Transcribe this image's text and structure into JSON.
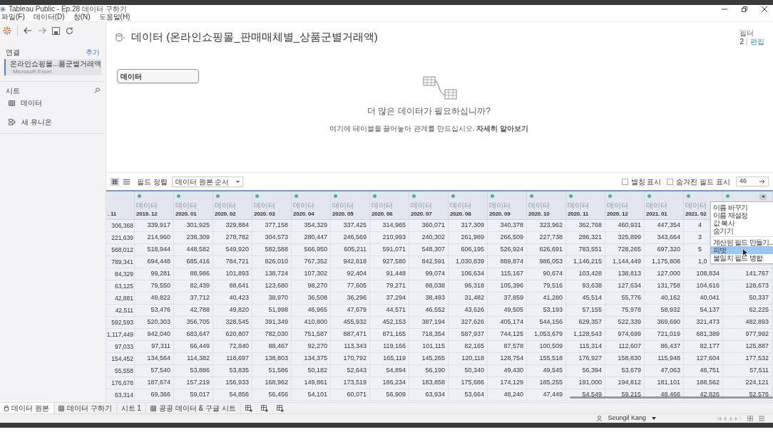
{
  "window": {
    "title": "Tableau Public - Ep.28 데이터 구하기"
  },
  "menu_bar": [
    "파일(F)",
    "데이터(D)",
    "창(N)",
    "도움말(H)"
  ],
  "sidebar": {
    "connections_label": "연결",
    "add_link": "추가",
    "connections": [
      {
        "name": "온라인쇼핑몰...품군별거래액",
        "type": "Microsoft Excel",
        "selected": true
      }
    ],
    "sheets_label": "시트",
    "sheets": [
      {
        "kind": "sheet",
        "label": "데이터"
      },
      {
        "kind": "union",
        "label": "새 유니온"
      }
    ]
  },
  "datasource": {
    "title": "데이터 (온라인쇼핑몰_판매매체별_상품군별거래액)",
    "filter_label": "필터",
    "filter_count": "2",
    "filter_edit": "편집"
  },
  "canvas": {
    "table": "데이터",
    "heading": "더 많은 데이터가 필요하십니까?",
    "hint": "여기에 테이블을 끌어놓아 관계를 만드십시오. **자세히 알아보기**"
  },
  "grid_toolbar": {
    "sort_label": "필드 정렬",
    "sort_value": "데이터 원본 순서",
    "options": [
      {
        "label": "별칭 표시",
        "checked": false
      },
      {
        "label": "숨겨진 필드 표시",
        "checked": false
      }
    ],
    "rows_value": "46"
  },
  "table": {
    "columns": [
      {
        "kind": "cut",
        "label": ". 11"
      },
      {
        "kind": "field",
        "type": "데이터",
        "label": "2019. 12",
        "menu_button": false
      },
      {
        "kind": "field",
        "type": "데이터",
        "label": "2020. 01",
        "menu_button": false
      },
      {
        "kind": "field",
        "type": "데이터",
        "label": "2020. 02",
        "menu_button": false
      },
      {
        "kind": "field",
        "type": "데이터",
        "label": "2020. 03",
        "menu_button": false
      },
      {
        "kind": "field",
        "type": "데이터",
        "label": "2020. 04",
        "menu_button": false
      },
      {
        "kind": "field",
        "type": "데이터",
        "label": "2020. 05",
        "menu_button": false
      },
      {
        "kind": "field",
        "type": "데이터",
        "label": "2020. 06",
        "menu_button": false
      },
      {
        "kind": "field",
        "type": "데이터",
        "label": "2020. 07",
        "menu_button": false
      },
      {
        "kind": "field",
        "type": "데이터",
        "label": "2020. 08",
        "menu_button": false
      },
      {
        "kind": "field",
        "type": "데이터",
        "label": "2020. 09",
        "menu_button": false
      },
      {
        "kind": "field",
        "type": "데이터",
        "label": "2020. 10",
        "menu_button": false
      },
      {
        "kind": "field",
        "type": "데이터",
        "label": "2020. 11",
        "menu_button": false
      },
      {
        "kind": "field",
        "type": "데이터",
        "label": "2020. 12",
        "menu_button": false
      },
      {
        "kind": "field",
        "type": "데이터",
        "label": "2021. 01",
        "menu_button": false
      },
      {
        "kind": "field",
        "type": "데이터",
        "label": "2021. 02",
        "menu_button": false
      },
      {
        "kind": "hidden",
        "menu_button": true
      }
    ],
    "rows": [
      {
        "cut": true,
        "cells": [
          "306,368",
          "339,917",
          "301,925",
          "329,884",
          "377,158",
          "354,329",
          "337,425",
          "314,965",
          "360,071",
          "317,309",
          "340,378",
          "323,962",
          "362,768",
          "460,931",
          "447,354",
          "4"
        ]
      },
      {
        "cut": true,
        "cells": [
          "221,639",
          "214,960",
          "238,309",
          "278,782",
          "304,573",
          "280,447",
          "246,569",
          "210,993",
          "240,302",
          "261,989",
          "266,509",
          "227,738",
          "286,321",
          "325,899",
          "343,664",
          "3"
        ]
      },
      {
        "cut": true,
        "cells": [
          "568,012",
          "518,944",
          "448,582",
          "549,920",
          "582,588",
          "566,950",
          "605,211",
          "591,071",
          "548,307",
          "606,195",
          "526,924",
          "626,691",
          "783,551",
          "728,265",
          "697,320",
          "5"
        ]
      },
      {
        "cut": true,
        "cells": [
          "789,341",
          "694,448",
          "685,416",
          "784,721",
          "826,010",
          "767,352",
          "942,818",
          "927,580",
          "842,591",
          "1,030,839",
          "889,874",
          "986,053",
          "1,146,215",
          "1,144,449",
          "1,175,808",
          "1,0"
        ]
      },
      {
        "cut": false,
        "cells": [
          "84,329",
          "99,281",
          "88,986",
          "101,893",
          "138,724",
          "107,302",
          "92,404",
          "91,448",
          "99,074",
          "106,634",
          "115,167",
          "90,674",
          "103,428",
          "138,813",
          "127,000",
          "108,834",
          "141,767"
        ]
      },
      {
        "cut": false,
        "cells": [
          "63,125",
          "79,550",
          "82,439",
          "88,641",
          "123,680",
          "98,270",
          "77,605",
          "79,271",
          "88,038",
          "96,318",
          "105,396",
          "79,516",
          "93,638",
          "127,634",
          "131,758",
          "104,616",
          "128,673"
        ]
      },
      {
        "cut": false,
        "cells": [
          "42,881",
          "49,822",
          "37,712",
          "40,423",
          "38,970",
          "36,508",
          "36,296",
          "37,294",
          "38,493",
          "31,482",
          "37,859",
          "41,280",
          "45,514",
          "55,776",
          "40,162",
          "40,041",
          "50,337"
        ]
      },
      {
        "cut": false,
        "cells": [
          "42,511",
          "53,476",
          "42,788",
          "49,820",
          "51,998",
          "46,965",
          "47,679",
          "44,571",
          "46,552",
          "43,626",
          "49,505",
          "53,193",
          "57,155",
          "75,978",
          "58,932",
          "54,137",
          "62,225"
        ]
      },
      {
        "cut": false,
        "cells": [
          "592,593",
          "520,303",
          "356,705",
          "328,545",
          "391,349",
          "410,800",
          "455,932",
          "452,153",
          "387,194",
          "327,626",
          "405,174",
          "544,156",
          "629,357",
          "522,339",
          "369,690",
          "321,473",
          "482,893"
        ]
      },
      {
        "cut": false,
        "cells": [
          "1,117,449",
          "942,040",
          "683,647",
          "620,807",
          "782,030",
          "751,587",
          "887,471",
          "871,165",
          "718,354",
          "587,937",
          "744,125",
          "1,053,679",
          "1,128,543",
          "974,699",
          "721,019",
          "681,389",
          "977,992"
        ]
      },
      {
        "cut": false,
        "cells": [
          "97,033",
          "97,311",
          "66,449",
          "72,840",
          "88,467",
          "92,270",
          "113,343",
          "119,166",
          "101,115",
          "82,165",
          "87,578",
          "100,509",
          "115,314",
          "112,607",
          "86,437",
          "82,177",
          "125,887"
        ]
      },
      {
        "cut": false,
        "cells": [
          "154,452",
          "134,564",
          "114,382",
          "118,697",
          "138,803",
          "134,375",
          "170,792",
          "165,119",
          "145,265",
          "120,118",
          "128,754",
          "155,518",
          "176,927",
          "158,830",
          "115,948",
          "127,604",
          "177,532"
        ]
      },
      {
        "cut": false,
        "cells": [
          "55,558",
          "57,540",
          "53,886",
          "53,835",
          "51,586",
          "50,182",
          "52,643",
          "54,894",
          "56,190",
          "50,340",
          "49,430",
          "49,545",
          "56,394",
          "53,679",
          "47,063",
          "48,751",
          "57,511"
        ]
      },
      {
        "cut": false,
        "cells": [
          "176,678",
          "187,674",
          "157,219",
          "156,933",
          "168,962",
          "149,861",
          "173,519",
          "186,234",
          "183,858",
          "175,686",
          "174,129",
          "185,255",
          "191,000",
          "194,812",
          "181,101",
          "188,562",
          "224,121"
        ]
      },
      {
        "cut": false,
        "cells": [
          "63,314",
          "69,366",
          "59,017",
          "54,856",
          "56,456",
          "54,101",
          "60,071",
          "56,909",
          "63,934",
          "53,664",
          "48,240",
          "47,449",
          "54,549",
          "59,215",
          "48,466",
          "42,826",
          "52,576"
        ]
      }
    ]
  },
  "context_menu": [
    {
      "kind": "item",
      "label": "이름 바꾸기",
      "selected": false
    },
    {
      "kind": "item",
      "label": "이름 재설정",
      "selected": false
    },
    {
      "kind": "item",
      "label": "값 복사",
      "selected": false
    },
    {
      "kind": "item",
      "label": "숨기기",
      "selected": false
    },
    {
      "kind": "separator"
    },
    {
      "kind": "item",
      "label": "계산된 필드 만들기...",
      "selected": false
    },
    {
      "kind": "item",
      "label": "피벗",
      "selected": true
    },
    {
      "kind": "item",
      "label": "불일치 필드 병합",
      "selected": false
    }
  ],
  "sheet_tabs": [
    {
      "kind": "source",
      "label": "데이터 원본",
      "selected": true
    },
    {
      "kind": "sheet",
      "label": "데이터 구하기",
      "selected": false
    },
    {
      "kind": "plain",
      "label": "시트 1",
      "selected": false
    },
    {
      "kind": "sheet",
      "label": "공공 데이터 & 구글 시트",
      "selected": false
    }
  ],
  "status_bar": {
    "user": "Seungil Kang"
  }
}
